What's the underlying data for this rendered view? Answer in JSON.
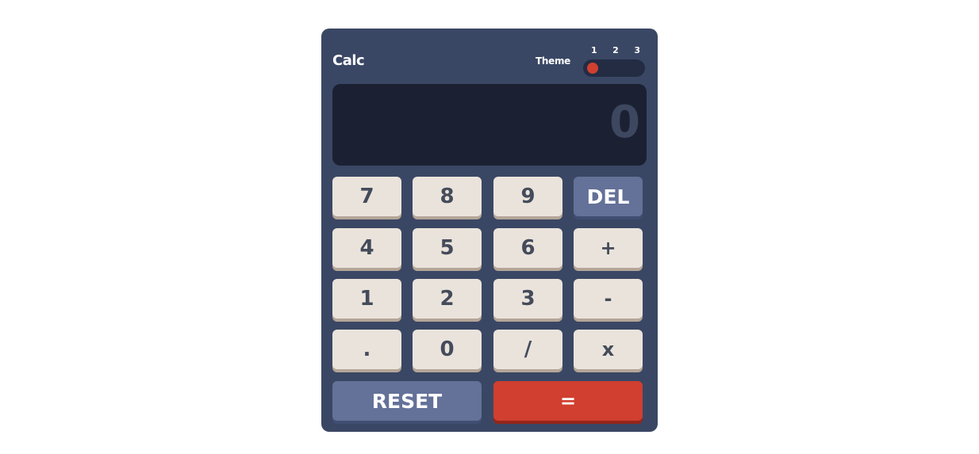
{
  "app": {
    "title": "Calc"
  },
  "theme": {
    "label": "Theme",
    "options": [
      "1",
      "2",
      "3"
    ],
    "selected": 1
  },
  "display": {
    "value": "0"
  },
  "keys": {
    "k7": "7",
    "k8": "8",
    "k9": "9",
    "del": "DEL",
    "k4": "4",
    "k5": "5",
    "k6": "6",
    "plus": "+",
    "k1": "1",
    "k2": "2",
    "k3": "3",
    "minus": "-",
    "dot": ".",
    "k0": "0",
    "divide": "/",
    "multiply": "x",
    "reset": "RESET",
    "equals": "="
  },
  "colors": {
    "background": "#3a4764",
    "screen": "#1b2133",
    "toggle_track": "#232c43",
    "key": "#eae3dc",
    "key_shadow": "#b4a597",
    "key_text": "#444b5a",
    "accent_blue": "#647198",
    "accent_red": "#d03f2f"
  }
}
